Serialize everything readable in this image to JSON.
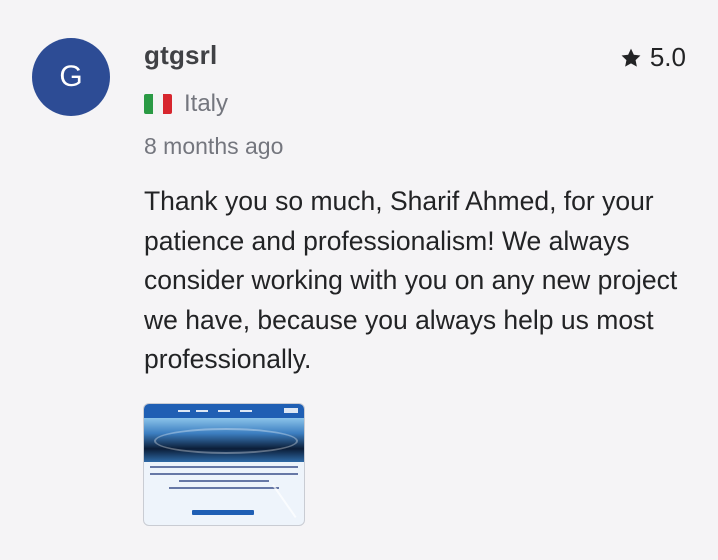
{
  "reviewer": {
    "initial": "G",
    "username": "gtgsrl",
    "country": "Italy",
    "flag_icon": "italy-flag-icon",
    "avatar_color": "#2d4c95"
  },
  "rating": {
    "value": "5.0",
    "icon": "star-icon"
  },
  "time_ago": "8 months ago",
  "review_text": "Thank you so much, Sharif Ahmed, for your patience and professionalism! We always consider working with you on any new project we have, because you always help us most professionally.",
  "attachment": {
    "type": "image-thumbnail"
  },
  "colors": {
    "background": "#f5f4f6",
    "text": "#222325",
    "muted": "#74767e"
  }
}
